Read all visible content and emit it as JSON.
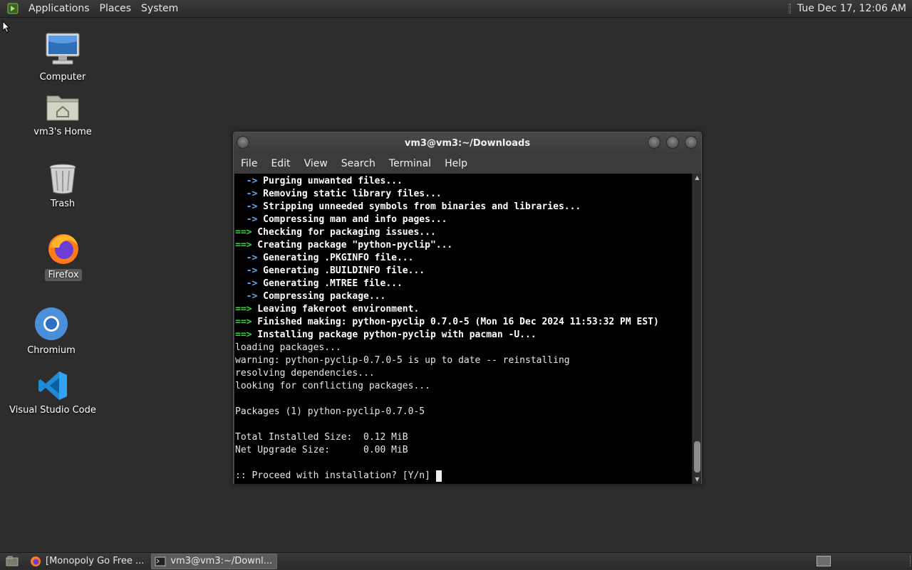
{
  "top_panel": {
    "menus": [
      "Applications",
      "Places",
      "System"
    ],
    "clock": "Tue Dec 17, 12:06 AM"
  },
  "desktop_icons": [
    {
      "label": "Computer",
      "icon": "computer-icon"
    },
    {
      "label": "vm3's Home",
      "icon": "home-folder-icon"
    },
    {
      "label": "Trash",
      "icon": "trash-icon"
    },
    {
      "label": "Firefox",
      "icon": "firefox-icon",
      "selected": true
    },
    {
      "label": "Chromium",
      "icon": "chromium-icon"
    },
    {
      "label": "Visual Studio Code",
      "icon": "vscode-icon"
    }
  ],
  "terminal": {
    "title": "vm3@vm3:~/Downloads",
    "menus": [
      "File",
      "Edit",
      "View",
      "Search",
      "Terminal",
      "Help"
    ],
    "lines": [
      {
        "prefix": "  ->",
        "prefix_color": "blue",
        "text": " Purging unwanted files...",
        "bold": true
      },
      {
        "prefix": "  ->",
        "prefix_color": "blue",
        "text": " Removing static library files...",
        "bold": true
      },
      {
        "prefix": "  ->",
        "prefix_color": "blue",
        "text": " Stripping unneeded symbols from binaries and libraries...",
        "bold": true
      },
      {
        "prefix": "  ->",
        "prefix_color": "blue",
        "text": " Compressing man and info pages...",
        "bold": true
      },
      {
        "prefix": "==>",
        "prefix_color": "green",
        "text": " Checking for packaging issues...",
        "bold": true
      },
      {
        "prefix": "==>",
        "prefix_color": "green",
        "text": " Creating package \"python-pyclip\"...",
        "bold": true
      },
      {
        "prefix": "  ->",
        "prefix_color": "blue",
        "text": " Generating .PKGINFO file...",
        "bold": true
      },
      {
        "prefix": "  ->",
        "prefix_color": "blue",
        "text": " Generating .BUILDINFO file...",
        "bold": true
      },
      {
        "prefix": "  ->",
        "prefix_color": "blue",
        "text": " Generating .MTREE file...",
        "bold": true
      },
      {
        "prefix": "  ->",
        "prefix_color": "blue",
        "text": " Compressing package...",
        "bold": true
      },
      {
        "prefix": "==>",
        "prefix_color": "green",
        "text": " Leaving fakeroot environment.",
        "bold": true
      },
      {
        "prefix": "==>",
        "prefix_color": "green",
        "text": " Finished making: python-pyclip 0.7.0-5 (Mon 16 Dec 2024 11:53:32 PM EST)",
        "bold": true
      },
      {
        "prefix": "==>",
        "prefix_color": "green",
        "text": " Installing package python-pyclip with pacman -U...",
        "bold": true
      },
      {
        "prefix": "",
        "prefix_color": "",
        "text": "loading packages...",
        "bold": false
      },
      {
        "prefix": "",
        "prefix_color": "",
        "text": "warning: python-pyclip-0.7.0-5 is up to date -- reinstalling",
        "bold": false
      },
      {
        "prefix": "",
        "prefix_color": "",
        "text": "resolving dependencies...",
        "bold": false
      },
      {
        "prefix": "",
        "prefix_color": "",
        "text": "looking for conflicting packages...",
        "bold": false
      },
      {
        "prefix": "",
        "prefix_color": "",
        "text": "",
        "bold": false
      },
      {
        "prefix": "",
        "prefix_color": "",
        "text": "Packages (1) python-pyclip-0.7.0-5",
        "bold": false
      },
      {
        "prefix": "",
        "prefix_color": "",
        "text": "",
        "bold": false
      },
      {
        "prefix": "",
        "prefix_color": "",
        "text": "Total Installed Size:  0.12 MiB",
        "bold": false
      },
      {
        "prefix": "",
        "prefix_color": "",
        "text": "Net Upgrade Size:      0.00 MiB",
        "bold": false
      },
      {
        "prefix": "",
        "prefix_color": "",
        "text": "",
        "bold": false
      },
      {
        "prefix": "",
        "prefix_color": "",
        "text": ":: Proceed with installation? [Y/n] ",
        "bold": false,
        "cursor": true
      }
    ]
  },
  "taskbar": {
    "tasks": [
      {
        "label": "[Monopoly Go Free ...",
        "icon": "firefox-icon",
        "active": false
      },
      {
        "label": "vm3@vm3:~/Downl...",
        "icon": "terminal-icon",
        "active": true
      }
    ]
  },
  "colors": {
    "prompt_green": "#39d139",
    "arrow_blue": "#6da7e3",
    "terminal_bg": "#000000",
    "desktop_bg": "#2d2d2d"
  }
}
